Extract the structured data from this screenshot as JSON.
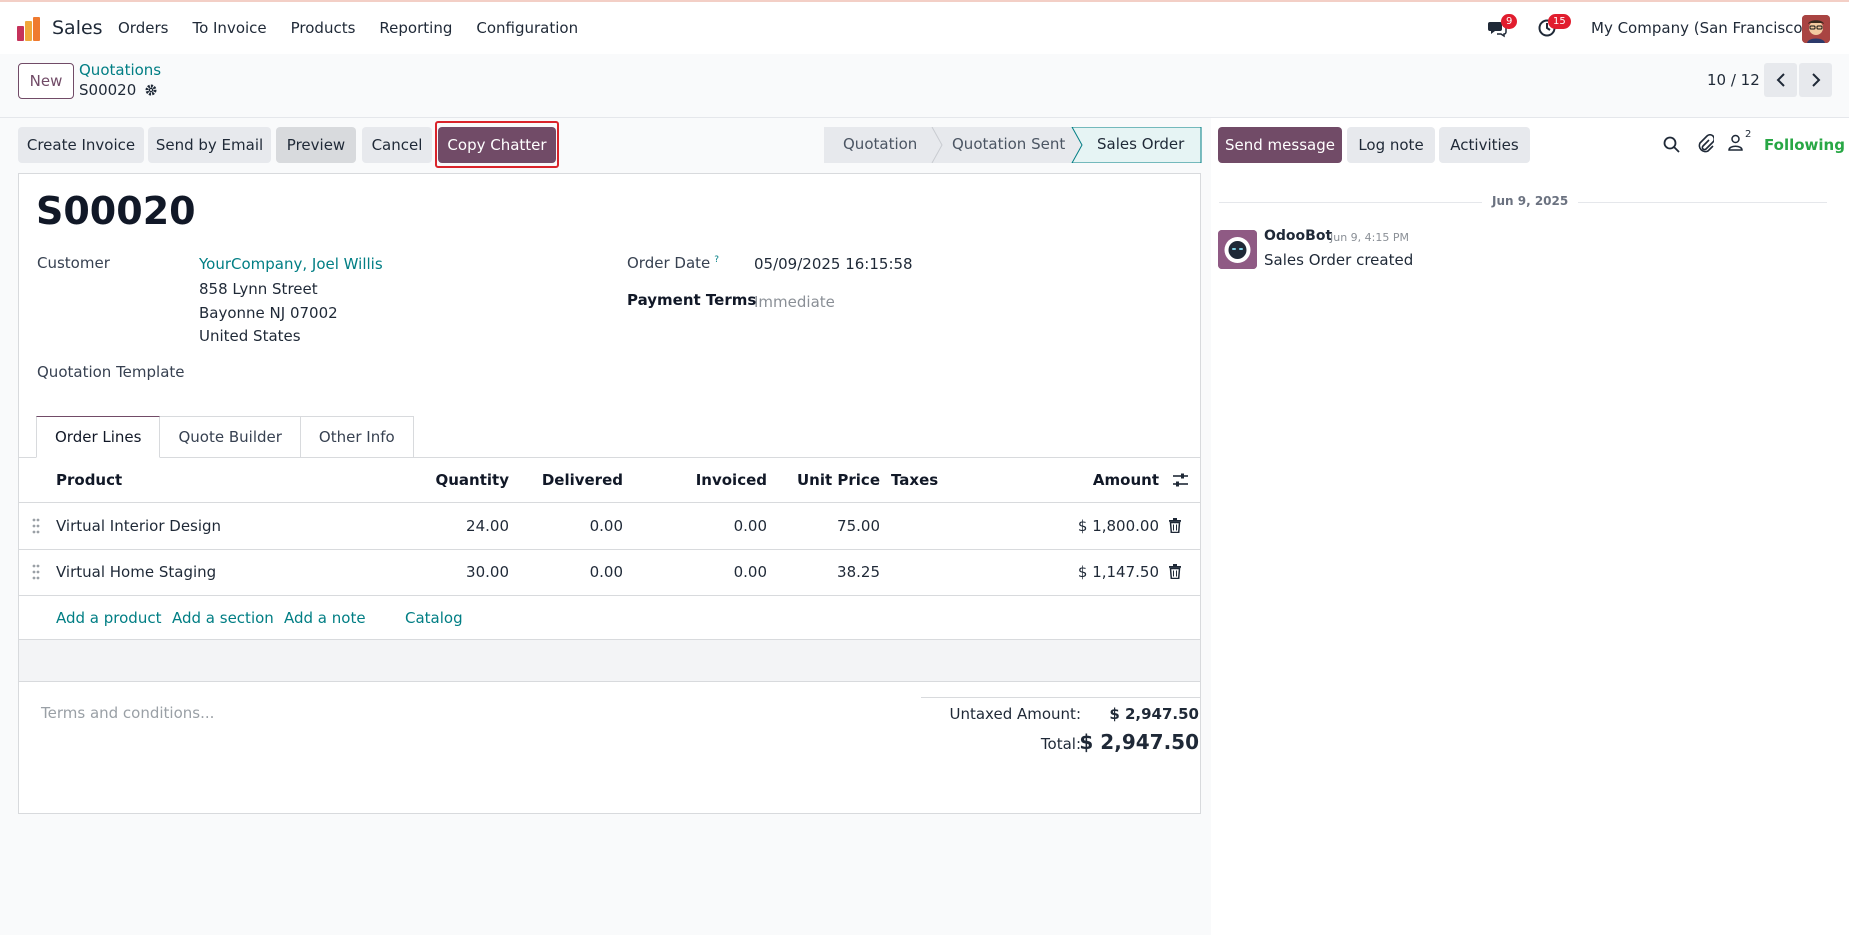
{
  "navbar": {
    "app_name": "Sales",
    "menu": [
      "Orders",
      "To Invoice",
      "Products",
      "Reporting",
      "Configuration"
    ],
    "messages_count": "9",
    "activities_count": "15",
    "company": "My Company (San Francisco)"
  },
  "control": {
    "new_label": "New",
    "breadcrumb_parent": "Quotations",
    "breadcrumb_current": "S00020",
    "pager": "10 / 12"
  },
  "actions": {
    "create_invoice": "Create Invoice",
    "send_by_email": "Send by Email",
    "preview": "Preview",
    "cancel": "Cancel",
    "copy_chatter": "Copy Chatter"
  },
  "status": {
    "stages": [
      "Quotation",
      "Quotation Sent",
      "Sales Order"
    ],
    "active": "Sales Order"
  },
  "form": {
    "name": "S00020",
    "customer_label": "Customer",
    "customer_name": "YourCompany, Joel Willis",
    "customer_street": "858 Lynn Street",
    "customer_city": "Bayonne NJ 07002",
    "customer_country": "United States",
    "quotation_template_label": "Quotation Template",
    "order_date_label": "Order Date",
    "order_date_help": "?",
    "order_date": "05/09/2025 16:15:58",
    "payment_terms_label": "Payment Terms",
    "payment_terms": "Immediate"
  },
  "tabs": [
    "Order Lines",
    "Quote Builder",
    "Other Info"
  ],
  "lines": {
    "headers": [
      "Product",
      "Quantity",
      "Delivered",
      "Invoiced",
      "Unit Price",
      "Taxes",
      "Amount"
    ],
    "rows": [
      {
        "product": "Virtual Interior Design",
        "quantity": "24.00",
        "delivered": "0.00",
        "invoiced": "0.00",
        "unit_price": "75.00",
        "taxes": "",
        "amount": "$ 1,800.00"
      },
      {
        "product": "Virtual Home Staging",
        "quantity": "30.00",
        "delivered": "0.00",
        "invoiced": "0.00",
        "unit_price": "38.25",
        "taxes": "",
        "amount": "$ 1,147.50"
      }
    ],
    "add_product": "Add a product",
    "add_section": "Add a section",
    "add_note": "Add a note",
    "catalog": "Catalog"
  },
  "footer": {
    "terms_placeholder": "Terms and conditions...",
    "untaxed_label": "Untaxed Amount:",
    "untaxed_value": "$ 2,947.50",
    "total_label": "Total:",
    "total_value": "$ 2,947.50"
  },
  "chatter": {
    "send_message": "Send message",
    "log_note": "Log note",
    "activities": "Activities",
    "followers_count": "2",
    "following": "Following",
    "date_separator": "Jun 9, 2025",
    "messages": [
      {
        "author": "OdooBot",
        "time": "Jun 9, 4:15 PM",
        "body": "Sales Order created"
      }
    ]
  },
  "colors": {
    "brand": "#714b67",
    "link": "#017e84",
    "highlight": "#d9242b",
    "following": "#28a745"
  }
}
